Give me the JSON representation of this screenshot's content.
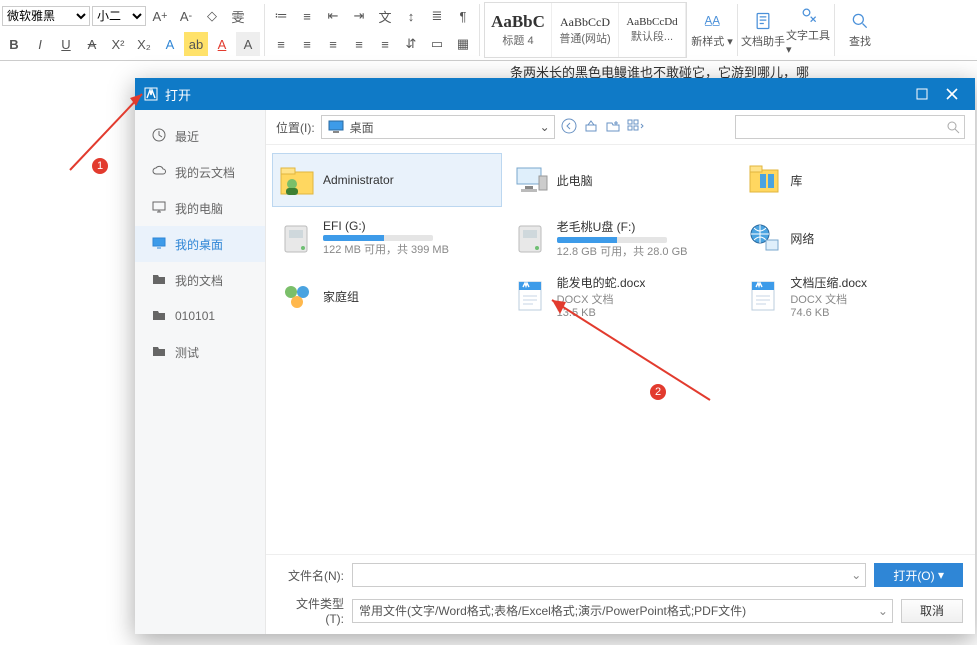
{
  "ribbon": {
    "font_name": "微软雅黑",
    "font_size": "小二",
    "styles": [
      {
        "preview": "AaBbC",
        "label": "标题 4",
        "size": "17px",
        "weight": "bold"
      },
      {
        "preview": "AaBbCcD",
        "label": "普通(网站)",
        "size": "12px",
        "weight": "normal"
      },
      {
        "preview": "AaBbCcDd",
        "label": "默认段...",
        "size": "11px",
        "weight": "normal"
      }
    ],
    "big_buttons": {
      "new_style": "新样式 ▾",
      "doc_helper": "文档助手",
      "text_tools": "文字工具 ▾",
      "find": "查找"
    }
  },
  "doc_peek": "条两米长的黑色电鳗谁也不敢碰它，它游到哪儿，哪",
  "dialog": {
    "title": "打开",
    "sidebar": [
      {
        "key": "recent",
        "label": "最近"
      },
      {
        "key": "cloud",
        "label": "我的云文档"
      },
      {
        "key": "pc",
        "label": "我的电脑"
      },
      {
        "key": "desktop",
        "label": "我的桌面",
        "active": true
      },
      {
        "key": "docs",
        "label": "我的文档"
      },
      {
        "key": "f010101",
        "label": "010101"
      },
      {
        "key": "test",
        "label": "测试"
      }
    ],
    "location_label": "位置(I):",
    "location_value": "桌面",
    "items": [
      {
        "kind": "folder-user",
        "name": "Administrator",
        "selected": true
      },
      {
        "kind": "pc",
        "name": "此电脑"
      },
      {
        "kind": "lib",
        "name": "库"
      },
      {
        "kind": "drive",
        "name": "EFI (G:)",
        "sub": "122 MB 可用，共 399 MB",
        "fill": 0.55
      },
      {
        "kind": "drive",
        "name": "老毛桃U盘 (F:)",
        "sub": "12.8 GB 可用，共 28.0 GB",
        "fill": 0.55
      },
      {
        "kind": "net",
        "name": "网络"
      },
      {
        "kind": "homegroup",
        "name": "家庭组"
      },
      {
        "kind": "docx",
        "name": "能发电的蛇.docx",
        "type": "DOCX 文档",
        "size": "13.5 KB"
      },
      {
        "kind": "docx",
        "name": "文档压缩.docx",
        "type": "DOCX 文档",
        "size": "74.6 KB"
      }
    ],
    "filename_label": "文件名(N):",
    "filename_value": "",
    "filetype_label": "文件类型(T):",
    "filetype_value": "常用文件(文字/Word格式;表格/Excel格式;演示/PowerPoint格式;PDF文件)",
    "open_btn": "打开(O)",
    "cancel_btn": "取消"
  },
  "annotations": {
    "b1": "1",
    "b2": "2"
  }
}
